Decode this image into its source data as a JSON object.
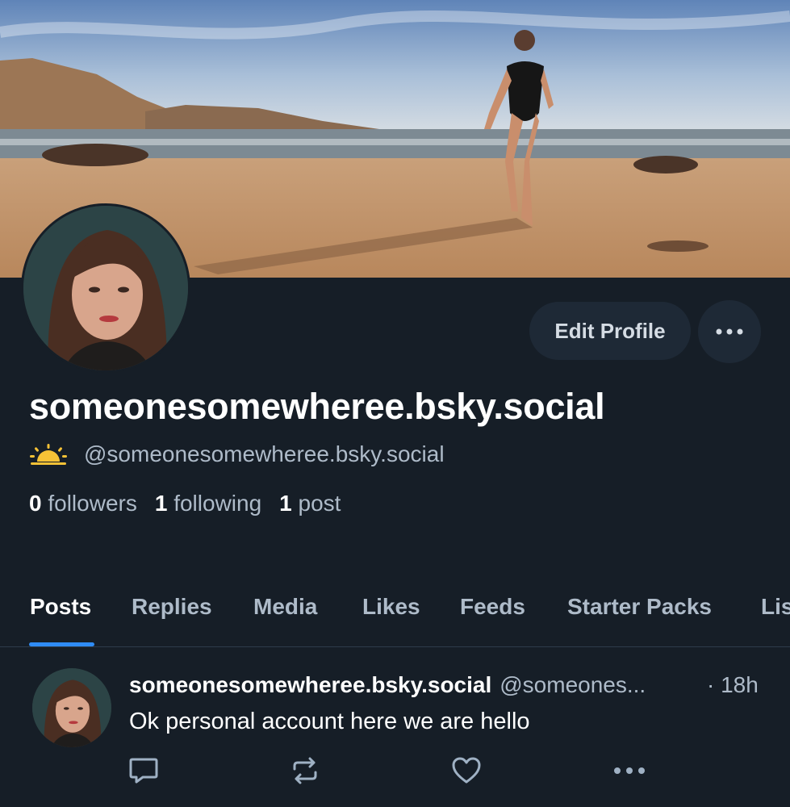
{
  "profile": {
    "display_name": "someonesomewheree.bsky.social",
    "handle": "@someonesomewheree.bsky.social",
    "edit_label": "Edit Profile",
    "stats": [
      {
        "count": "0",
        "label": "followers"
      },
      {
        "count": "1",
        "label": "following"
      },
      {
        "count": "1",
        "label": "post"
      }
    ]
  },
  "tabs": [
    "Posts",
    "Replies",
    "Media",
    "Likes",
    "Feeds",
    "Starter Packs",
    "Lis"
  ],
  "active_tab": "Posts",
  "post": {
    "author_name": "someonesomewheree.bsky.social",
    "author_handle": "@someones...",
    "time": "· 18h",
    "text": "Ok personal account here we are hello"
  },
  "icons": [
    "sunrise-emoji-icon",
    "more-icon",
    "reply-icon",
    "repost-icon",
    "like-icon",
    "post-more-icon"
  ],
  "colors": {
    "background": "#161e27",
    "accent": "#2f8cf5",
    "muted_text": "#aebbc9",
    "button_bg": "#1e2936"
  }
}
